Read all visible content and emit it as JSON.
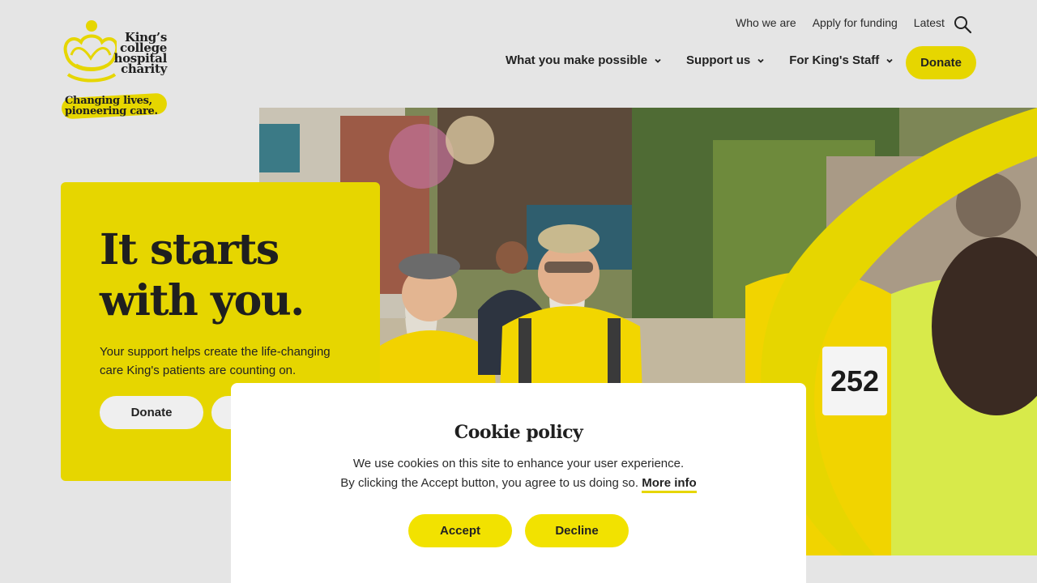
{
  "logo": {
    "name_lines": [
      "King’s",
      "college",
      "hospital",
      "charity"
    ],
    "tagline_lines": [
      "Changing lives,",
      "pioneering care."
    ]
  },
  "util_nav": [
    "Who we are",
    "Apply for funding",
    "Latest"
  ],
  "main_nav": [
    {
      "label": "What you make possible"
    },
    {
      "label": "Support us"
    },
    {
      "label": "For King's Staff"
    }
  ],
  "header_donate_label": "Donate",
  "hero": {
    "title_lines": [
      "It starts",
      "with you."
    ],
    "subtitle": "Your support helps create the life-changing care King's patients are counting on.",
    "donate_label": "Donate",
    "runner_number": "252"
  },
  "cookie": {
    "title": "Cookie policy",
    "line1": "We use cookies on this site to enhance your user experience.",
    "line2_prefix": "By clicking the Accept button, you agree to us doing so.",
    "more_info": "More info",
    "accept": "Accept",
    "decline": "Decline"
  },
  "colors": {
    "brand_yellow": "#e6d600",
    "background": "#e5e5e5",
    "text": "#222222"
  }
}
